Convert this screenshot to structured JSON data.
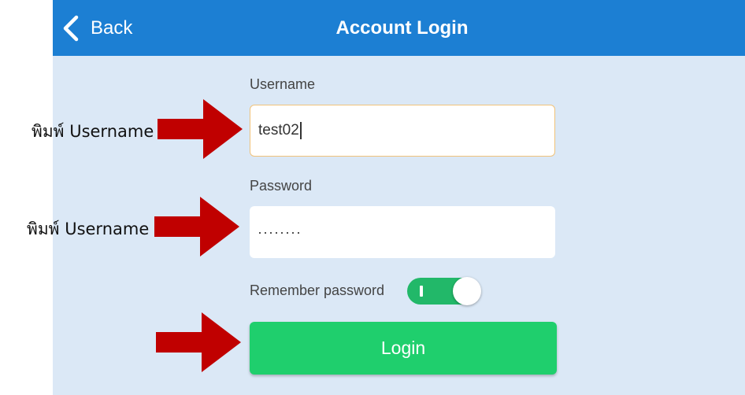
{
  "header": {
    "back_label": "Back",
    "title": "Account Login"
  },
  "form": {
    "username_label": "Username",
    "username_value": "test02",
    "password_label": "Password",
    "password_value": "········",
    "remember_label": "Remember password",
    "remember_checked": true,
    "login_label": "Login"
  },
  "annotations": {
    "username_note": "พิมพ์ Username",
    "password_note": "พิมพ์ Username"
  },
  "colors": {
    "header_bg": "#1c7fd3",
    "page_bg": "#dbe8f6",
    "login_green": "#1fcf6d",
    "toggle_green": "#22b869",
    "arrow_red": "#c00000"
  },
  "icons": {
    "back": "chevron-left-icon",
    "callout": "right-arrow-icon"
  }
}
